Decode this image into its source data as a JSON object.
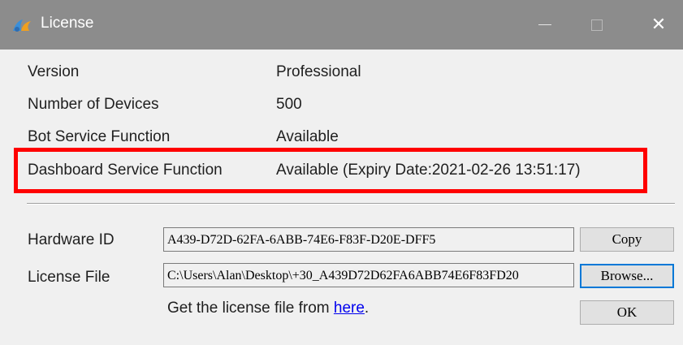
{
  "window": {
    "title": "License",
    "icon": "app-logo-icon",
    "controls": {
      "minimize": "minimize-icon",
      "maximize": "maximize-icon",
      "close": "close-icon",
      "close_glyph": "✕"
    }
  },
  "info": [
    {
      "label": "Version",
      "value": "Professional"
    },
    {
      "label": "Number of Devices",
      "value": "500"
    },
    {
      "label": "Bot Service Function",
      "value": "Available"
    },
    {
      "label": "Dashboard Service Function",
      "value": "Available (Expiry Date:2021-02-26 13:51:17)"
    }
  ],
  "hardware": {
    "label": "Hardware ID",
    "value": "A439-D72D-62FA-6ABB-74E6-F83F-D20E-DFF5",
    "button": "Copy"
  },
  "license_file": {
    "label": "License File",
    "value": "C:\\Users\\Alan\\Desktop\\+30_A439D72D62FA6ABB74E6F83FD20",
    "button": "Browse..."
  },
  "hint": {
    "text": "Get the license file from ",
    "link": "here",
    "suffix": "."
  },
  "ok_button": "OK",
  "colors": {
    "titlebar": "#8c8c8c",
    "highlight": "#ff0000",
    "link": "#0000ee",
    "default_button_border": "#0078d7"
  }
}
